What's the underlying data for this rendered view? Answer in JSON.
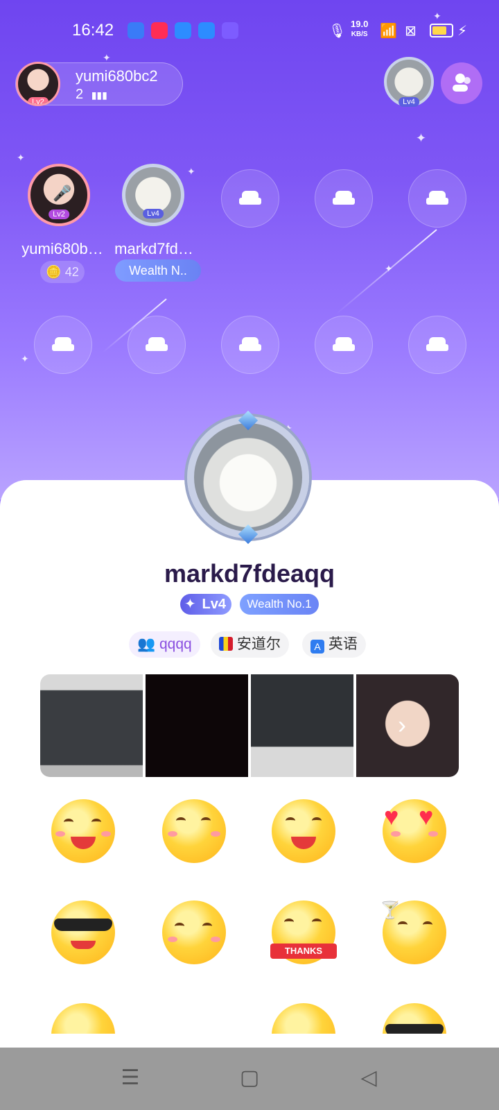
{
  "status_bar": {
    "time": "16:42",
    "network_speed_value": "19.0",
    "network_speed_unit": "KB/S"
  },
  "room": {
    "host_name": "yumi680bc2",
    "host_level": "Lv2",
    "online_count": "2",
    "right_avatar_level": "Lv4"
  },
  "seats": {
    "seat1": {
      "name": "yumi680b…",
      "level": "Lv2",
      "coins": "42"
    },
    "seat2": {
      "name": "markd7fd…",
      "level": "Lv4",
      "badge": "Wealth N.."
    }
  },
  "profile": {
    "name": "markd7fdeaqq",
    "level_label": "Lv4",
    "wealth_label": "Wealth No.1",
    "tags": [
      {
        "icon": "group-icon",
        "label": "qqqq"
      },
      {
        "icon": "andorra-flag-icon",
        "label": "安道尔"
      },
      {
        "icon": "language-icon",
        "label": "英语"
      }
    ]
  },
  "emojis": [
    "laughing-emoji",
    "hugging-emoji",
    "tears-of-joy-emoji",
    "heart-eyes-emoji",
    "sunglasses-emoji",
    "smirk-emoji",
    "thanks-emoji",
    "drink-wink-emoji"
  ],
  "colors": {
    "accent": "#7c55f3",
    "sheet": "#ffffff",
    "name": "#2a1a4a"
  }
}
